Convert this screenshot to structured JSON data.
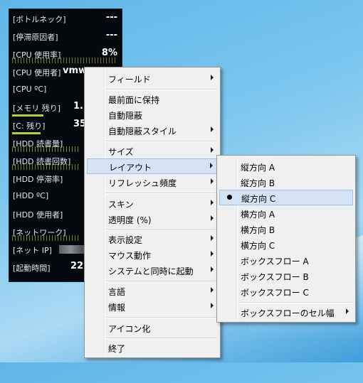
{
  "widget": {
    "rows": [
      {
        "label": "[ボトルネック]",
        "value": "---"
      },
      {
        "label": "[停滞原因者]",
        "value": "---"
      },
      {
        "label": "[CPU 使用率]",
        "value": "8%"
      },
      {
        "label": "[CPU 使用者]",
        "value": "vmw"
      },
      {
        "label": "[CPU ºC]",
        "value": ""
      },
      {
        "label": "[メモリ 残り]",
        "value": "1."
      },
      {
        "label": "[C: 残り]",
        "value": "35"
      },
      {
        "label": "[HDD 読書量]",
        "value": ""
      },
      {
        "label": "[HDD 読書回数]",
        "value": ""
      },
      {
        "label": "[HDD 停滞率]",
        "value": ""
      },
      {
        "label": "[HDD ºC]",
        "value": ""
      },
      {
        "label": "[HDD 使用者]",
        "value": ""
      },
      {
        "label": "[ネットワーク]",
        "value": ""
      },
      {
        "label": "[ネット IP]",
        "value": ""
      },
      {
        "label": "[起動時間]",
        "value": "22"
      }
    ]
  },
  "context_menu": {
    "items": [
      {
        "label": "フィールド"
      },
      {
        "label": "最前面に保持"
      },
      {
        "label": "自動隠蔽"
      },
      {
        "label": "自動隠蔽スタイル"
      },
      {
        "label": "サイズ"
      },
      {
        "label": "レイアウト"
      },
      {
        "label": "リフレッシュ頻度"
      },
      {
        "label": "スキン"
      },
      {
        "label": "透明度 (%)"
      },
      {
        "label": "表示設定"
      },
      {
        "label": "マウス動作"
      },
      {
        "label": "システムと同時に起動"
      },
      {
        "label": "言語"
      },
      {
        "label": "情報"
      },
      {
        "label": "アイコン化"
      },
      {
        "label": "終了"
      }
    ]
  },
  "layout_submenu": {
    "items": [
      {
        "label": "縦方向 A"
      },
      {
        "label": "縦方向 B"
      },
      {
        "label": "縦方向 C",
        "selected": true
      },
      {
        "label": "横方向 A"
      },
      {
        "label": "横方向 B"
      },
      {
        "label": "横方向 C"
      },
      {
        "label": "ボックスフロー A"
      },
      {
        "label": "ボックスフロー B"
      },
      {
        "label": "ボックスフロー C"
      },
      {
        "label": "ボックスフローのセル幅"
      }
    ]
  },
  "colors": {
    "menu_bg": "#f0f0f0",
    "highlight": "#d5e4f5",
    "widget_bg": "#05080d",
    "bar": "#b7d230"
  }
}
